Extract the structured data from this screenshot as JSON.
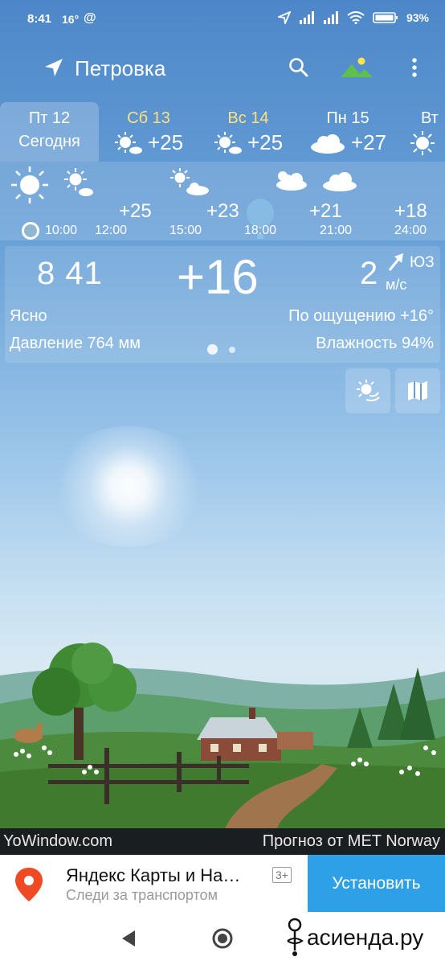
{
  "status_bar": {
    "time": "8:41",
    "temp": "16°",
    "at_symbol": "@",
    "battery_pct": "93%",
    "icons": [
      "location-arrow-icon",
      "signal-icon",
      "signal-icon",
      "wifi-icon",
      "battery-icon"
    ]
  },
  "header": {
    "city": "Петровка",
    "icons": [
      "location-arrow-icon",
      "search-icon",
      "landscape-icon",
      "menu-dots-icon"
    ]
  },
  "days": [
    {
      "name": "Пт 12",
      "sub": "Сегодня",
      "selected": true,
      "weekend": false
    },
    {
      "name": "Сб 13",
      "temp": "+25",
      "weekend": true,
      "icon": "sun-cloud-icon"
    },
    {
      "name": "Вс 14",
      "temp": "+25",
      "weekend": true,
      "icon": "sun-cloud-icon"
    },
    {
      "name": "Пн 15",
      "temp": "+27",
      "weekend": false,
      "icon": "cloud-icon"
    },
    {
      "name": "Вт",
      "weekend": false,
      "icon": "sun-icon"
    }
  ],
  "hourly": {
    "temps": [
      "+25",
      "+23",
      "+21",
      "+18"
    ],
    "times": [
      "10:00",
      "12:00",
      "15:00",
      "18:00",
      "21:00",
      "24:00"
    ]
  },
  "current": {
    "clock": "8 41",
    "temp": "+16",
    "wind_speed": "2",
    "wind_unit": "м/с",
    "wind_dir": "ЮЗ",
    "condition": "Ясно",
    "feels_like": "По ощущению +16°",
    "pressure": "Давление 764 мм",
    "humidity": "Влажность 94%"
  },
  "footer": {
    "brand": "YoWindow.com",
    "source": "Прогноз от MET Norway"
  },
  "ad": {
    "title": "Яндекс Карты и На…",
    "subtitle": "Следи за транспортом",
    "rating": "3+",
    "install": "Установить"
  },
  "watermark": "асиенда.ру",
  "colors": {
    "weekend": "#ffe07a",
    "install_bg": "#2ea0e8",
    "pin": "#f04a25"
  }
}
